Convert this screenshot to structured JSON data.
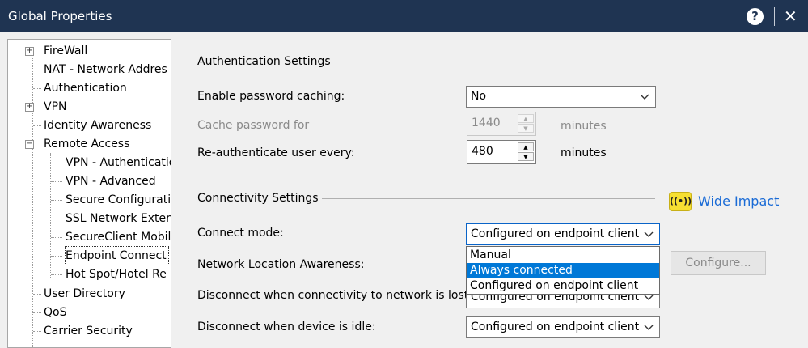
{
  "window": {
    "title": "Global Properties",
    "help_glyph": "?",
    "close_glyph": "✕"
  },
  "tree": {
    "items": [
      {
        "label": "FireWall",
        "expander": "+"
      },
      {
        "label": "NAT - Network Addres"
      },
      {
        "label": "Authentication"
      },
      {
        "label": "VPN",
        "expander": "+"
      },
      {
        "label": "Identity Awareness"
      },
      {
        "label": "Remote Access",
        "expander": "−"
      },
      {
        "label": "VPN - Authenticatio"
      },
      {
        "label": "VPN - Advanced"
      },
      {
        "label": "Secure Configurati"
      },
      {
        "label": "SSL Network Exter"
      },
      {
        "label": "SecureClient Mobil"
      },
      {
        "label": "Endpoint Connect",
        "selected": true
      },
      {
        "label": "Hot Spot/Hotel Re"
      },
      {
        "label": "User Directory"
      },
      {
        "label": "QoS"
      },
      {
        "label": "Carrier Security"
      }
    ]
  },
  "auth": {
    "title": "Authentication Settings",
    "pw_caching_label": "Enable password caching:",
    "pw_caching_value": "No",
    "cache_pw_label": "Cache password for",
    "cache_pw_value": "1440",
    "cache_pw_unit": "minutes",
    "reauth_label": "Re-authenticate user every:",
    "reauth_value": "480",
    "reauth_unit": "minutes"
  },
  "conn": {
    "title": "Connectivity Settings",
    "wide_impact": "Wide Impact",
    "wide_icon_glyph": "((•))",
    "connect_mode_label": "Connect mode:",
    "connect_mode_value": "Configured on endpoint client",
    "nla_label": "Network Location Awareness:",
    "configure_label": "Configure...",
    "disconnect_lost_label": "Disconnect when connectivity to network is lost:",
    "disconnect_lost_value": "Configured on endpoint client",
    "disconnect_idle_label": "Disconnect when device is idle:",
    "disconnect_idle_value": "Configured on endpoint client",
    "options": [
      "Manual",
      "Always connected",
      "Configured on endpoint client"
    ],
    "highlighted_option": "Always connected"
  },
  "icons": {
    "chevron": "chevron-down-icon",
    "spin_up": "▲",
    "spin_down": "▼"
  },
  "colors": {
    "titlebar": "#1f3452",
    "highlight": "#0078d7",
    "wide_impact": "#1a6bd6",
    "wide_icon_bg": "#f6df32"
  }
}
